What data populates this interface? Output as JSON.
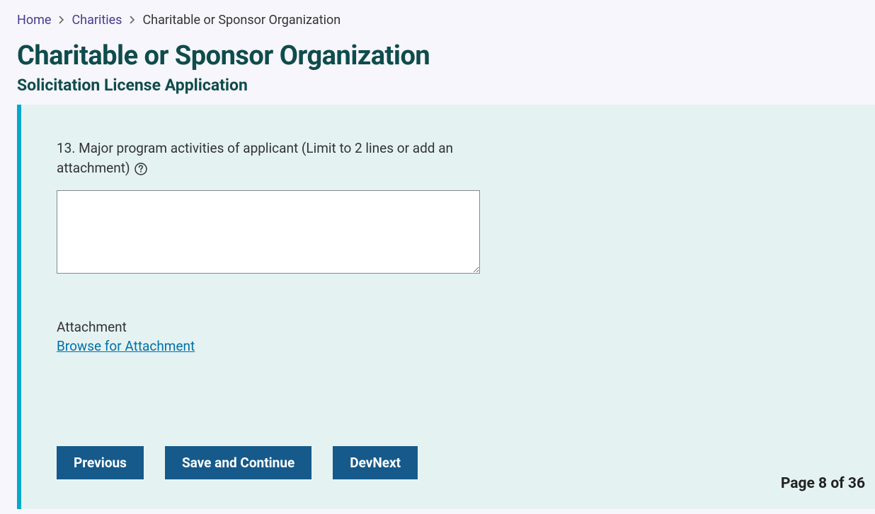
{
  "breadcrumb": {
    "home": "Home",
    "charities": "Charities",
    "current": "Charitable or Sponsor Organization"
  },
  "header": {
    "title": "Charitable or Sponsor Organization",
    "subtitle": "Solicitation License Application"
  },
  "form": {
    "question": "13. Major program activities of applicant (Limit to 2 lines or add an attachment)",
    "textarea_value": "",
    "attachment_label": "Attachment",
    "browse_label": "Browse for Attachment"
  },
  "buttons": {
    "previous": "Previous",
    "save_continue": "Save and Continue",
    "dev_next": "DevNext"
  },
  "pagination": {
    "label": "Page 8 of 36"
  }
}
